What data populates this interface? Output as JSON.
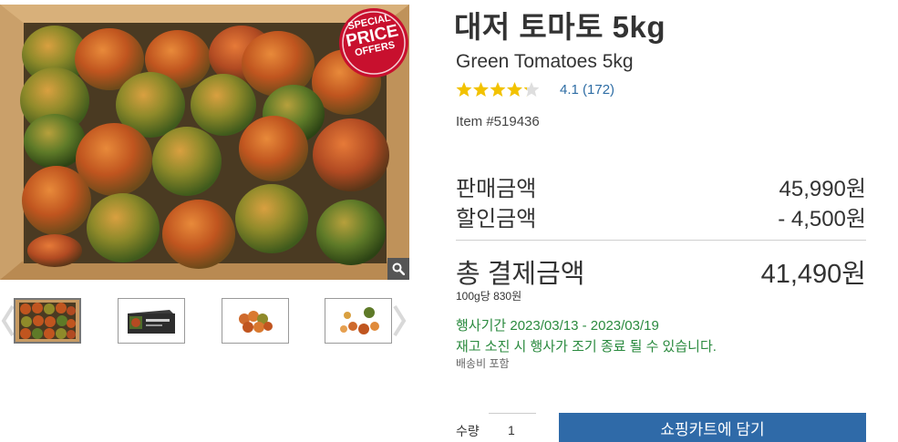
{
  "gallery": {
    "main_image_alt": "",
    "badge": {
      "line1": "SPECIAL",
      "line2": "PRICE",
      "line3": "OFFERS",
      "color": "#c8102e"
    },
    "zoom_icon": "magnifier-icon",
    "prev_icon": "chevron-left-icon",
    "next_icon": "chevron-right-icon"
  },
  "product": {
    "title_ko": "대저 토마토 5kg",
    "title_en": "Green Tomatoes 5kg",
    "rating_value": 4.1,
    "rating_text": "4.1 (172)",
    "item_number": "Item #519436"
  },
  "pricing": {
    "sale_label": "판매금액",
    "sale_amount": "45,990원",
    "discount_label": "할인금액",
    "discount_amount": "- 4,500원",
    "total_label": "총 결제금액",
    "total_amount": "41,490원",
    "unit_price": "100g당 830원"
  },
  "promo": {
    "period": "행사기간 2023/03/13 - 2023/03/19",
    "note": "재고 소진 시 행사가 조기 종료 될 수 있습니다.",
    "shipping": "배송비 포함",
    "color": "#2a8a3e"
  },
  "purchase": {
    "qty_label": "수량",
    "qty_value": "1",
    "cart_button": "쇼핑카트에 담기",
    "button_color": "#2f6aa8"
  }
}
